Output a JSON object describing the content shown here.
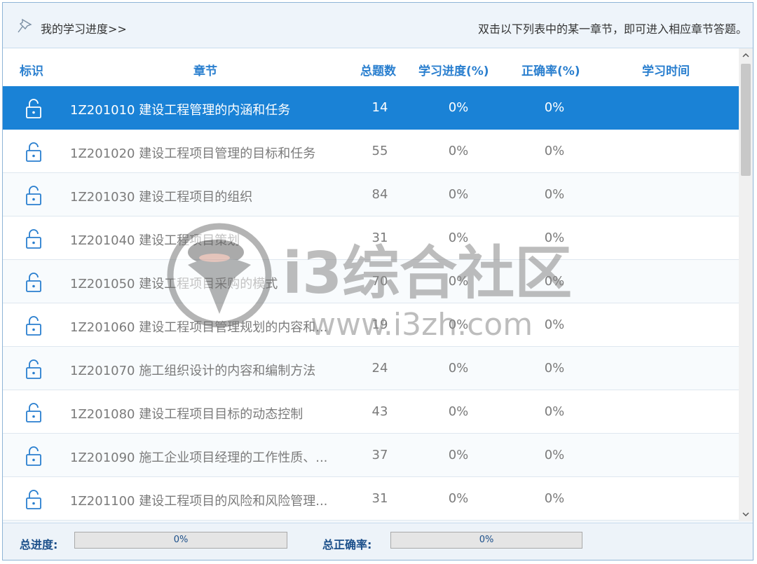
{
  "topbar": {
    "title": "我的学习进度>>",
    "hint": "双击以下列表中的某一章节，即可进入相应章节答题。",
    "pin_icon": "pin-icon"
  },
  "columns": {
    "mark": "标识",
    "chapter": "章节",
    "total": "总题数",
    "progress": "学习进度(%)",
    "accuracy": "正确率(%)",
    "time": "学习时间"
  },
  "rows": [
    {
      "chapter": "1Z201010 建设工程管理的内涵和任务",
      "total": "14",
      "progress": "0%",
      "accuracy": "0%",
      "time": "",
      "icon": "unlock-icon",
      "selected": true
    },
    {
      "chapter": "1Z201020 建设工程项目管理的目标和任务",
      "total": "55",
      "progress": "0%",
      "accuracy": "0%",
      "time": "",
      "icon": "unlock-icon"
    },
    {
      "chapter": "1Z201030 建设工程项目的组织",
      "total": "84",
      "progress": "0%",
      "accuracy": "0%",
      "time": "",
      "icon": "unlock-icon"
    },
    {
      "chapter": "1Z201040 建设工程项目策划",
      "total": "31",
      "progress": "0%",
      "accuracy": "0%",
      "time": "",
      "icon": "unlock-icon"
    },
    {
      "chapter": "1Z201050 建设工程项目采购的模式",
      "total": "70",
      "progress": "0%",
      "accuracy": "0%",
      "time": "",
      "icon": "unlock-icon"
    },
    {
      "chapter": "1Z201060 建设工程项目管理规划的内容和...",
      "total": "19",
      "progress": "0%",
      "accuracy": "0%",
      "time": "",
      "icon": "unlock-icon"
    },
    {
      "chapter": "1Z201070 施工组织设计的内容和编制方法",
      "total": "24",
      "progress": "0%",
      "accuracy": "0%",
      "time": "",
      "icon": "unlock-icon"
    },
    {
      "chapter": "1Z201080 建设工程项目目标的动态控制",
      "total": "43",
      "progress": "0%",
      "accuracy": "0%",
      "time": "",
      "icon": "unlock-icon"
    },
    {
      "chapter": "1Z201090 施工企业项目经理的工作性质、...",
      "total": "37",
      "progress": "0%",
      "accuracy": "0%",
      "time": "",
      "icon": "unlock-icon"
    },
    {
      "chapter": "1Z201100 建设工程项目的风险和风险管理...",
      "total": "31",
      "progress": "0%",
      "accuracy": "0%",
      "time": "",
      "icon": "unlock-icon"
    }
  ],
  "footer": {
    "total_progress_label": "总进度:",
    "total_progress_value": "0%",
    "total_accuracy_label": "总正确率:",
    "total_accuracy_value": "0%"
  },
  "watermark": {
    "brand": "i3综合社区",
    "url": "www.i3zh.com"
  },
  "colors": {
    "accent": "#1a82d6",
    "header_text": "#2a7fcf",
    "icon": "#2a7fcf"
  }
}
